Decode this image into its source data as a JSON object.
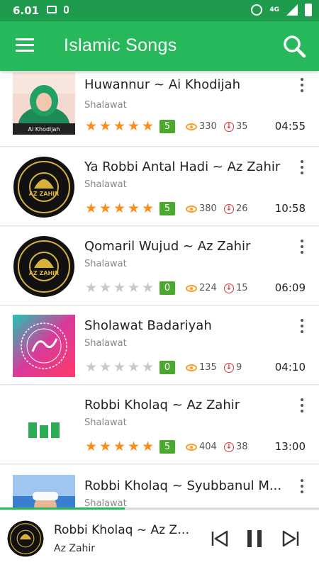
{
  "status_bar": {
    "time": "6.01",
    "network": "4G"
  },
  "app_bar": {
    "title": "Islamic Songs",
    "menu_icon": "hamburger-menu-icon",
    "search_icon": "search-icon"
  },
  "songs": [
    {
      "title": "Huwannur ~ Ai Khodijah",
      "category": "Shalawat",
      "rating": 5,
      "rating_count": "5",
      "views": "330",
      "downloads": "35",
      "duration": "04:55",
      "thumb_text": "Ai Khodijah"
    },
    {
      "title": "Ya Robbi Antal Hadi ~ Az Zahir",
      "category": "Shalawat",
      "rating": 5,
      "rating_count": "5",
      "views": "380",
      "downloads": "26",
      "duration": "10:58",
      "thumb_text": "AZ ZAHIR"
    },
    {
      "title": "Qomaril Wujud ~ Az Zahir",
      "category": "Shalawat",
      "rating": 0,
      "rating_count": "0",
      "views": "224",
      "downloads": "15",
      "duration": "06:09",
      "thumb_text": "AZ ZAHIR"
    },
    {
      "title": "Sholawat Badariyah",
      "category": "Shalawat",
      "rating": 0,
      "rating_count": "0",
      "views": "135",
      "downloads": "9",
      "duration": "04:10"
    },
    {
      "title": "Robbi Kholaq ~ Az Zahir",
      "category": "Shalawat",
      "rating": 5,
      "rating_count": "5",
      "views": "404",
      "downloads": "38",
      "duration": "13:00"
    },
    {
      "title": "Robbi Kholaq ~ Syubbanul M...",
      "category": "Shalawat"
    }
  ],
  "player": {
    "title": "Robbi Kholaq ~ Az Za...",
    "artist": "Az Zahir",
    "progress": 0.39
  },
  "colors": {
    "appbar": "#26b85a",
    "statusbar": "#1f9b4d",
    "star": "#ff8c1a",
    "badge": "#4ba82e",
    "views_icon": "#ff9c2a",
    "downloads_icon": "#e0302e"
  }
}
